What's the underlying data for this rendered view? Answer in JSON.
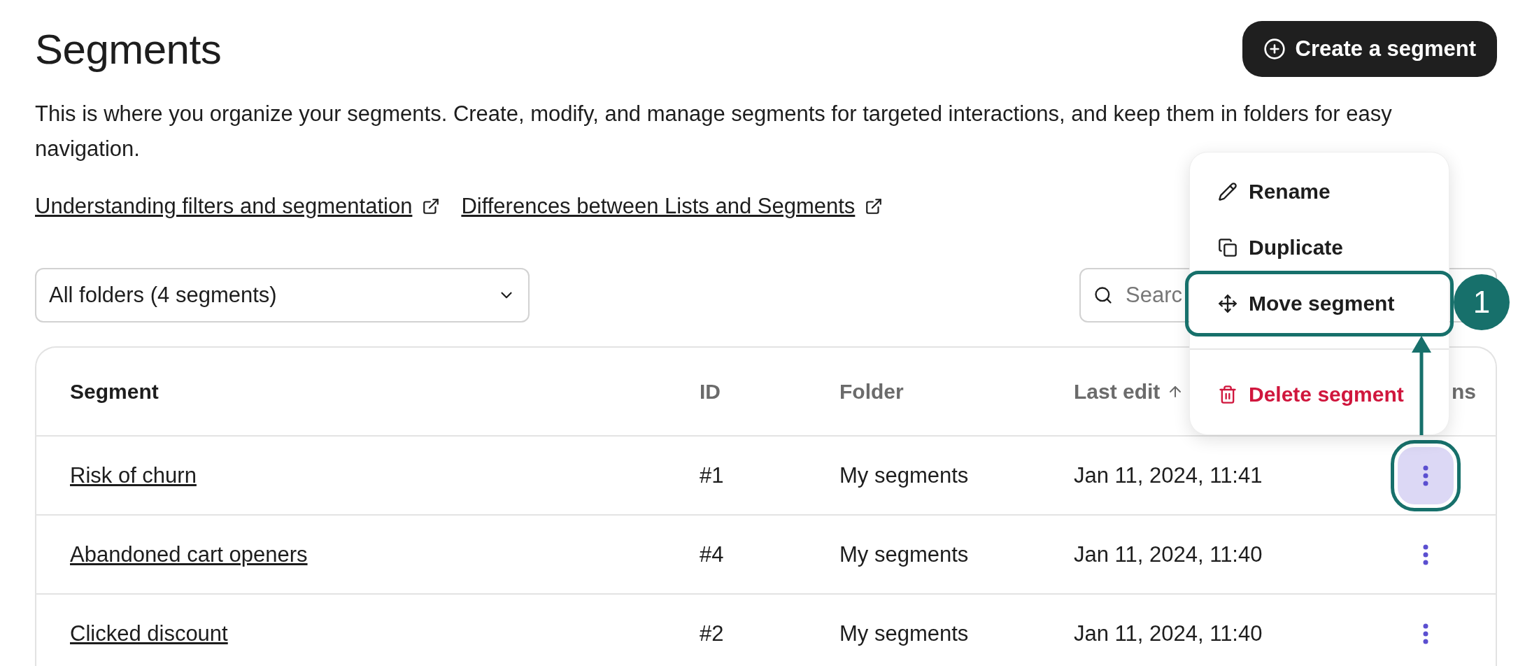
{
  "page": {
    "title": "Segments",
    "create_button": "Create a segment",
    "description": "This is where you organize your segments. Create, modify, and manage segments for targeted interactions, and keep them in folders for easy navigation.",
    "links": [
      "Understanding filters and segmentation",
      "Differences between Lists and Segments"
    ]
  },
  "folder_select": {
    "value": "All folders (4 segments)"
  },
  "search": {
    "placeholder": "Searc"
  },
  "table": {
    "columns": [
      {
        "label": "Segment",
        "sorted": false
      },
      {
        "label": "ID",
        "sorted": false
      },
      {
        "label": "Folder",
        "sorted": false
      },
      {
        "label": "Last edit",
        "sorted": true
      },
      {
        "label": "ns",
        "sorted": false
      }
    ],
    "rows": [
      {
        "segment": "Risk of churn",
        "id": "#1",
        "folder": "My segments",
        "last_edit": "Jan 11, 2024, 11:41",
        "menu_open": true
      },
      {
        "segment": "Abandoned cart openers",
        "id": "#4",
        "folder": "My segments",
        "last_edit": "Jan 11, 2024, 11:40",
        "menu_open": false
      },
      {
        "segment": "Clicked discount",
        "id": "#2",
        "folder": "My segments",
        "last_edit": "Jan 11, 2024, 11:40",
        "menu_open": false
      }
    ]
  },
  "context_menu": {
    "items": [
      {
        "kind": "rename",
        "label": "Rename",
        "highlighted": false
      },
      {
        "kind": "duplicate",
        "label": "Duplicate",
        "highlighted": false
      },
      {
        "kind": "move",
        "label": "Move segment",
        "highlighted": true
      },
      {
        "kind": "delete",
        "label": "Delete segment",
        "highlighted": false
      }
    ]
  },
  "annotation": {
    "badge": "1"
  }
}
